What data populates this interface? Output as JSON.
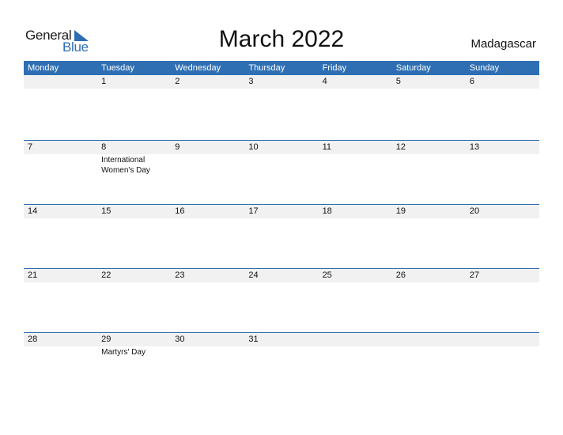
{
  "logo": {
    "part1": "General",
    "part2": "Blue"
  },
  "title": "March 2022",
  "country": "Madagascar",
  "colors": {
    "accent": "#2e6fb4",
    "date_bar": "#f1f1f1"
  },
  "weekdays": [
    "Monday",
    "Tuesday",
    "Wednesday",
    "Thursday",
    "Friday",
    "Saturday",
    "Sunday"
  ],
  "weeks": [
    {
      "days": [
        "",
        "1",
        "2",
        "3",
        "4",
        "5",
        "6"
      ],
      "events": [
        "",
        "",
        "",
        "",
        "",
        "",
        ""
      ]
    },
    {
      "days": [
        "7",
        "8",
        "9",
        "10",
        "11",
        "12",
        "13"
      ],
      "events": [
        "",
        "International Women's Day",
        "",
        "",
        "",
        "",
        ""
      ]
    },
    {
      "days": [
        "14",
        "15",
        "16",
        "17",
        "18",
        "19",
        "20"
      ],
      "events": [
        "",
        "",
        "",
        "",
        "",
        "",
        ""
      ]
    },
    {
      "days": [
        "21",
        "22",
        "23",
        "24",
        "25",
        "26",
        "27"
      ],
      "events": [
        "",
        "",
        "",
        "",
        "",
        "",
        ""
      ]
    },
    {
      "days": [
        "28",
        "29",
        "30",
        "31",
        "",
        "",
        ""
      ],
      "events": [
        "",
        "Martyrs' Day",
        "",
        "",
        "",
        "",
        ""
      ]
    }
  ]
}
